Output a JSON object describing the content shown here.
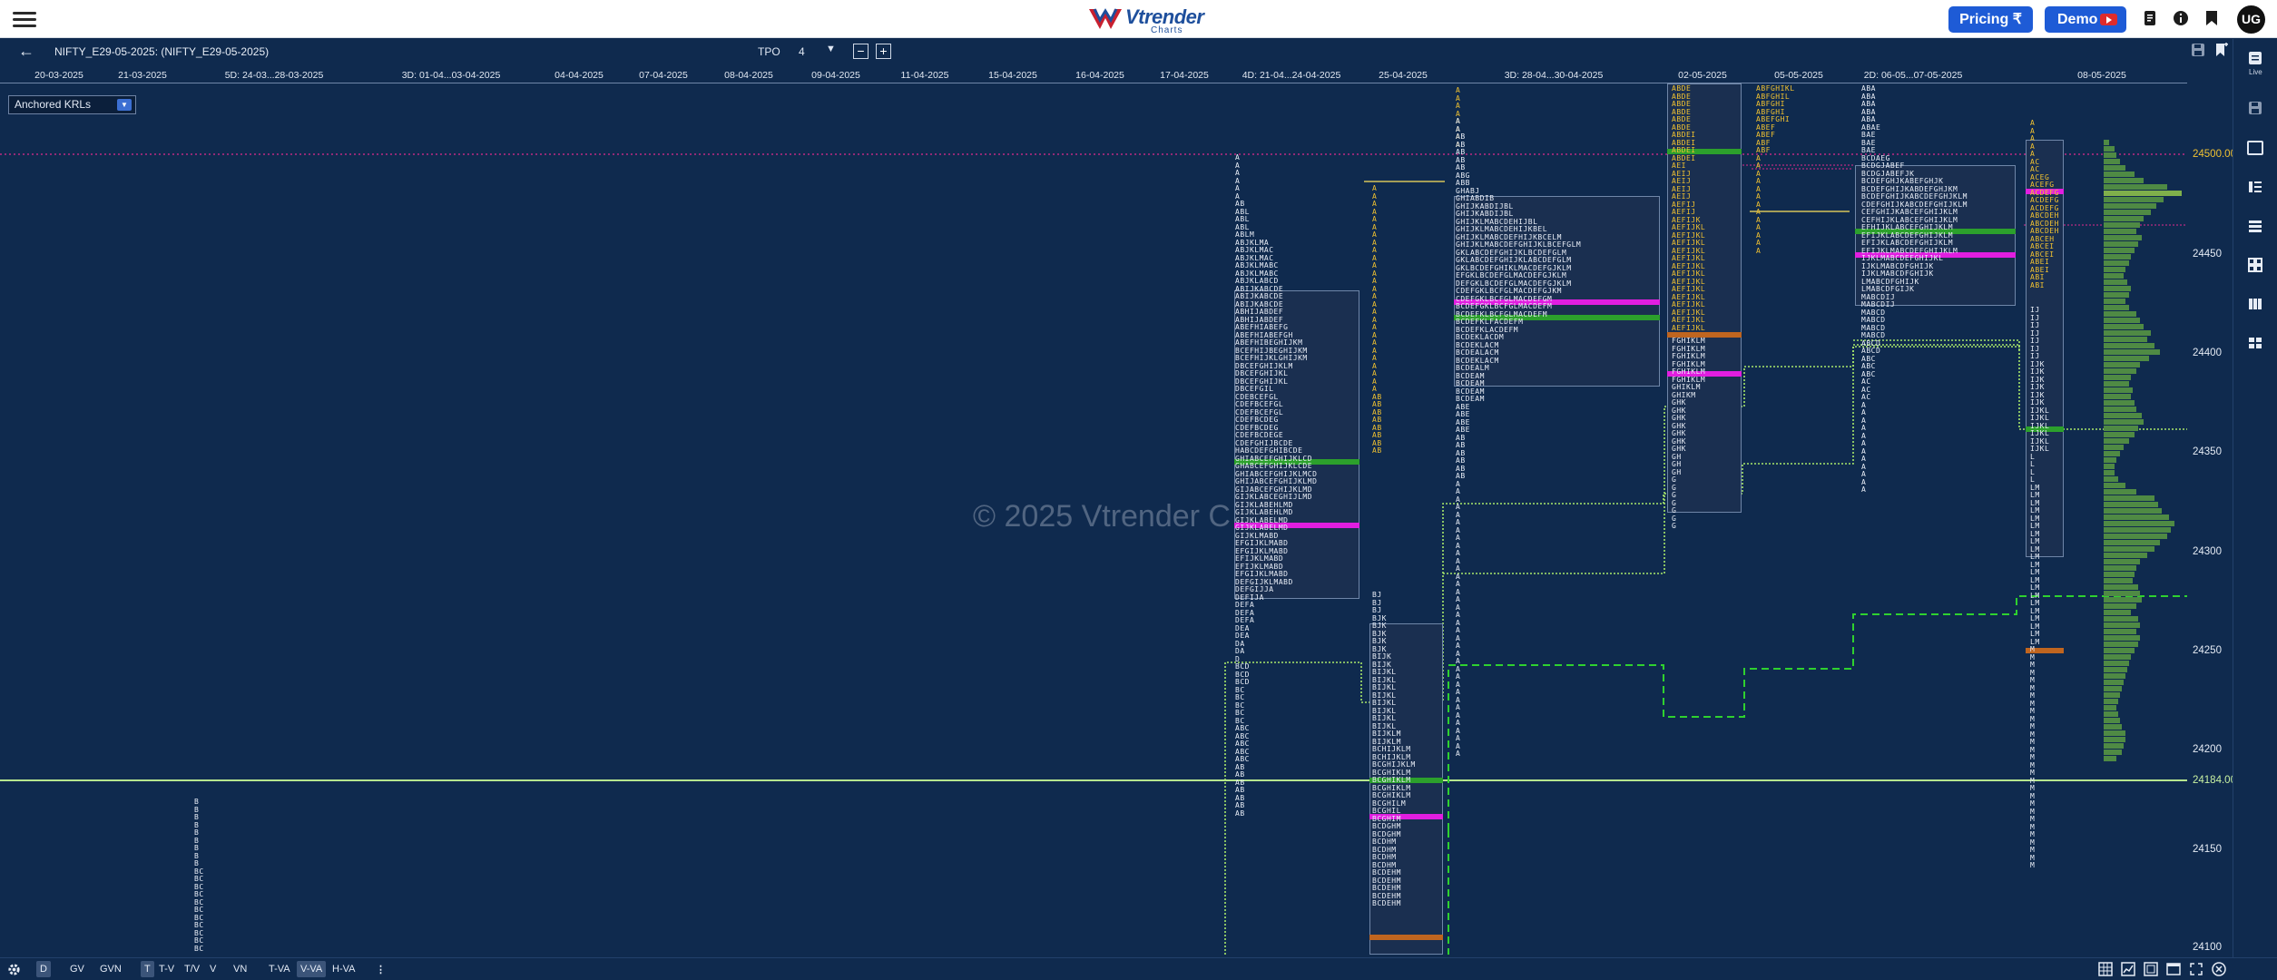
{
  "header": {
    "brand": "Vtrender",
    "brand_sub": "Charts",
    "pricing_label": "Pricing ₹",
    "demo_label": "Demo",
    "user_initials": "UG"
  },
  "toolbar": {
    "symbol": "NIFTY_E29-05-2025: (NIFTY_E29-05-2025)",
    "tpo_label": "TPO",
    "tpo_value": "4",
    "minus": "−",
    "plus": "+"
  },
  "dates": [
    "20-03-2025",
    "21-03-2025",
    "5D: 24-03...28-03-2025",
    "3D: 01-04...03-04-2025",
    "04-04-2025",
    "07-04-2025",
    "08-04-2025",
    "09-04-2025",
    "11-04-2025",
    "15-04-2025",
    "16-04-2025",
    "17-04-2025",
    "4D: 21-04...24-04-2025",
    "25-04-2025",
    "3D: 28-04...30-04-2025",
    "02-05-2025",
    "05-05-2025",
    "2D: 06-05...07-05-2025",
    "08-05-2025"
  ],
  "krl": {
    "label": "Anchored KRLs"
  },
  "price_axis": {
    "labels": [
      "24500.00",
      "24450",
      "24400",
      "24350",
      "24300",
      "24250",
      "24200",
      "24184.00",
      "24150",
      "24100"
    ]
  },
  "watermark": "© 2025 Vtrender C",
  "bottom_bar": {
    "items": [
      "D",
      "GV",
      "GVN",
      "T",
      "T-V",
      "T/V",
      "V",
      "VN",
      "T-VA",
      "V-VA",
      "H-VA"
    ]
  },
  "rail": {
    "live_label": "Live"
  },
  "colors": {
    "background": "#0f2a4e",
    "poc_green": "#2ca02c",
    "poc_magenta": "#e11ee0",
    "vpoc_orange": "#c0651f",
    "yellow_line": "#f1c232",
    "light_green_line": "#c9f2a2"
  }
}
